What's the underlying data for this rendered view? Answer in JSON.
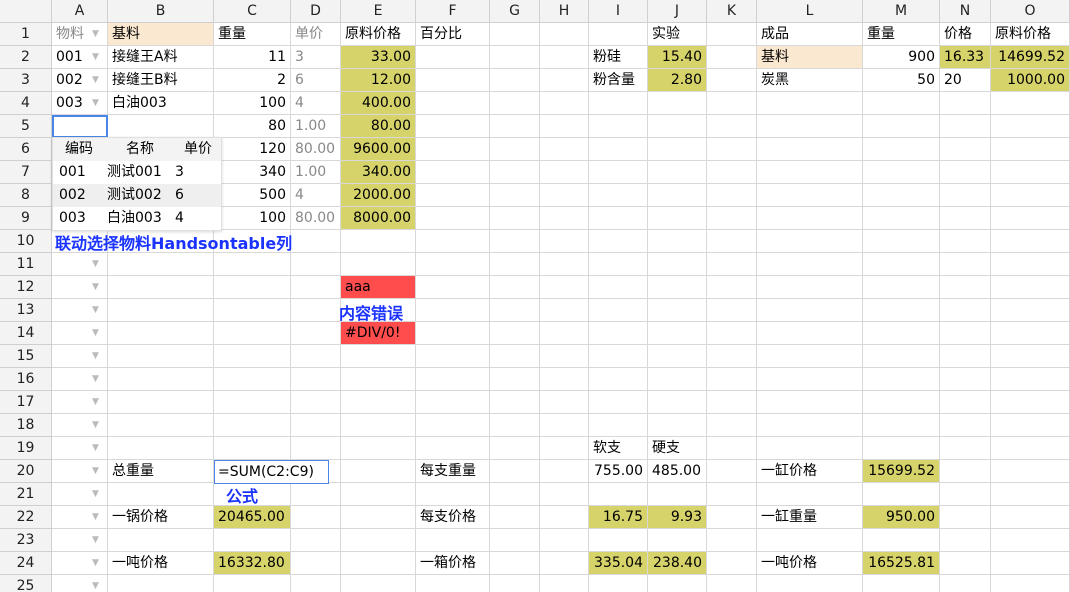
{
  "columns": [
    "A",
    "B",
    "C",
    "D",
    "E",
    "F",
    "G",
    "H",
    "I",
    "J",
    "K",
    "L",
    "M",
    "N",
    "O"
  ],
  "rows": [
    "1",
    "2",
    "3",
    "4",
    "5",
    "6",
    "7",
    "8",
    "9",
    "10",
    "11",
    "12",
    "13",
    "14",
    "15",
    "16",
    "17",
    "18",
    "19",
    "20",
    "21",
    "22",
    "23",
    "24",
    "25"
  ],
  "header_row": {
    "A": "物料",
    "B": "基料",
    "C": "重量",
    "D": "单价",
    "E": "原料价格",
    "F": "百分比",
    "J": "实验",
    "L": "成品",
    "M": "重量",
    "N": "价格",
    "O": "原料价格"
  },
  "materials": [
    {
      "code": "001",
      "name": "接缝王A料",
      "weight": "11",
      "price": "3",
      "cost": "33.00"
    },
    {
      "code": "002",
      "name": "接缝王B料",
      "weight": "2",
      "price": "6",
      "cost": "12.00"
    },
    {
      "code": "003",
      "name": "白油003",
      "weight": "100",
      "price": "4",
      "cost": "400.00"
    },
    {
      "code": "",
      "name": "",
      "weight": "80",
      "price": "1.00",
      "cost": "80.00"
    },
    {
      "code": "",
      "name": "",
      "weight": "120",
      "price": "80.00",
      "cost": "9600.00"
    },
    {
      "code": "",
      "name": "",
      "weight": "340",
      "price": "1.00",
      "cost": "340.00"
    },
    {
      "code": "",
      "name": "",
      "weight": "500",
      "price": "4",
      "cost": "2000.00"
    },
    {
      "code": "",
      "name": "",
      "weight": "100",
      "price": "80.00",
      "cost": "8000.00"
    }
  ],
  "experiment": {
    "powder_silicon_label": "粉硅",
    "powder_silicon_value": "15.40",
    "powder_content_label": "粉含量",
    "powder_content_value": "2.80"
  },
  "product": {
    "base_label": "基料",
    "base_weight": "900",
    "base_price": "16.33",
    "base_cost": "14699.52",
    "black_label": "炭黑",
    "black_weight": "50",
    "black_price": "20",
    "black_cost": "1000.00"
  },
  "dropdown": {
    "headers": [
      "编码",
      "名称",
      "单价"
    ],
    "items": [
      [
        "001",
        "测试001",
        "3"
      ],
      [
        "002",
        "测试002",
        "6"
      ],
      [
        "003",
        "白油003",
        "4"
      ]
    ]
  },
  "annotations": {
    "linked_select": "联动选择物料Handsontable列",
    "content_error": "内容错误",
    "formula": "公式"
  },
  "errors": {
    "text_value": "aaa",
    "div_zero": "#DIV/0!"
  },
  "summary": {
    "total_weight_label": "总重量",
    "total_weight_formula": "=SUM(C2:C9)",
    "pot_price_label": "一锅价格",
    "pot_price_value": "20465.00",
    "ton_price_label": "一吨价格",
    "ton_price_value": "16332.80"
  },
  "per_stick": {
    "soft_label": "软支",
    "hard_label": "硬支",
    "weight_label": "每支重量",
    "weight_soft": "755.00",
    "weight_hard": "485.00",
    "price_label": "每支价格",
    "price_soft": "16.75",
    "price_hard": "9.93",
    "box_label": "一箱价格",
    "box_soft": "335.04",
    "box_hard": "238.40"
  },
  "vat": {
    "vat_price_label": "一缸价格",
    "vat_price_value": "15699.52",
    "vat_weight_label": "一缸重量",
    "vat_weight_value": "950.00",
    "ton_price_label": "一吨价格",
    "ton_price_value": "16525.81"
  },
  "colors": {
    "highlight_yellow": "#d6d36a",
    "peach": "#fbe8d0",
    "error_red": "#ff4d4d",
    "note_blue": "#1a33ff",
    "selection_blue": "#4a86e8"
  },
  "icons": {
    "dropdown_arrow": "chevron-down-icon"
  }
}
